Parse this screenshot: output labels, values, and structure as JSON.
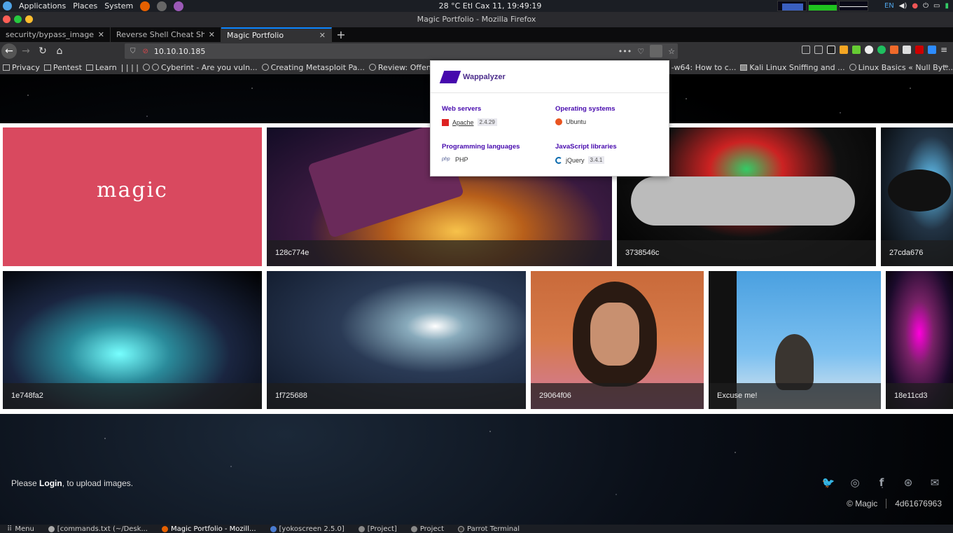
{
  "system_bar": {
    "apps": [
      "Applications",
      "Places",
      "System"
    ],
    "weather_clock": "28 °C   Etl Cax 11, 19:49:19",
    "lang": "EN"
  },
  "window": {
    "title": "Magic Portfolio - Mozilla Firefox"
  },
  "tabs": [
    {
      "label": "security/bypass_image_"
    },
    {
      "label": "Reverse Shell Cheat Sheet |"
    },
    {
      "label": "Magic Portfolio"
    }
  ],
  "url": "10.10.10.185",
  "bookmarks": [
    "Privacy",
    "Pentest",
    "Learn",
    "| | | |",
    "Cyberint - Are you vuln...",
    "Creating Metasploit Pa...",
    "Review: Offensive",
    "-w64: How to c...",
    "Kali Linux Sniffing and ...",
    "Linux Basics « Null Byt..."
  ],
  "wappalyzer": {
    "brand": "Wappalyzer",
    "sections": [
      {
        "category": "Web servers",
        "items": [
          {
            "name": "Apache",
            "version": "2.4.29"
          }
        ]
      },
      {
        "category": "Operating systems",
        "items": [
          {
            "name": "Ubuntu",
            "version": ""
          }
        ]
      },
      {
        "category": "Programming languages",
        "items": [
          {
            "name": "PHP",
            "version": ""
          }
        ]
      },
      {
        "category": "JavaScript libraries",
        "items": [
          {
            "name": "jQuery",
            "version": "3.4.1"
          }
        ]
      }
    ]
  },
  "gallery": {
    "logo_text": "magic",
    "captions": [
      "128c774e",
      "3738546c",
      "27cda676",
      "1e748fa2",
      "1f725688",
      "29064f06",
      "Excuse me!",
      "18e11cd3"
    ]
  },
  "footer": {
    "prefix": "Please ",
    "login_link": "Login",
    "suffix": ", to upload images.",
    "copyright": "© Magic",
    "hash": "4d61676963",
    "social_icons": [
      "twitter-icon",
      "instagram-icon",
      "facebook-icon",
      "dribbble-icon",
      "mail-icon"
    ]
  },
  "taskbar": [
    "Menu",
    "[commands.txt (~/Desk...",
    "Magic Portfolio - Mozill...",
    "[yokoscreen 2.5.0]",
    "[Project]",
    "Project",
    "Parrot Terminal"
  ],
  "colors": {
    "accent": "#0a84ff",
    "wappalyzer_purple": "#4608ad",
    "magic_tile": "#d9495f"
  }
}
